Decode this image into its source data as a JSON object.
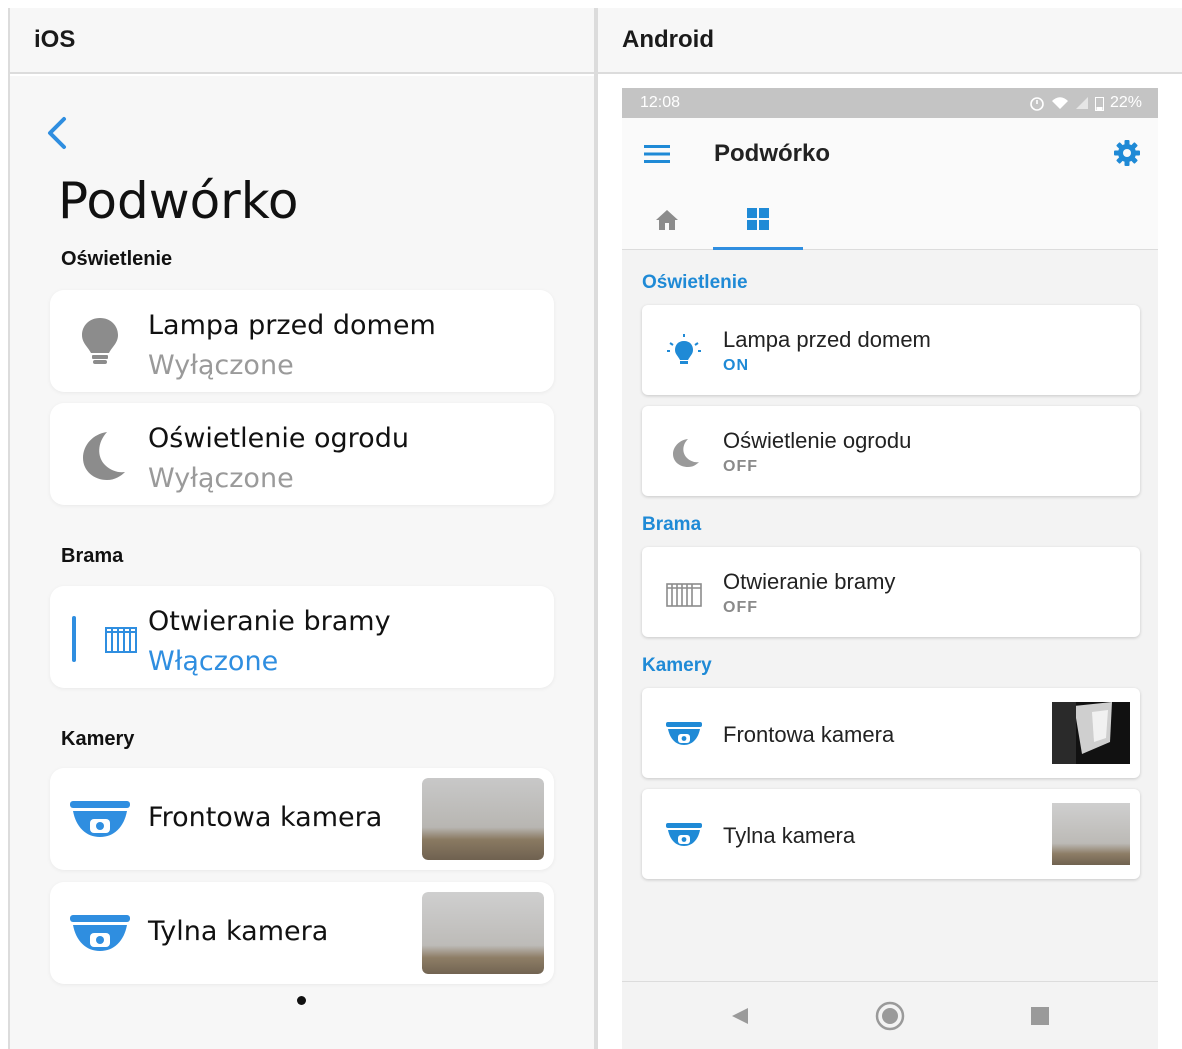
{
  "columns": {
    "ios": "iOS",
    "android": "Android"
  },
  "ios": {
    "title": "Podwórko",
    "sections": {
      "lighting": "Oświetlenie",
      "gate": "Brama",
      "cameras": "Kamery"
    },
    "devices": {
      "lamp": {
        "name": "Lampa przed domem",
        "state": "Wyłączone",
        "icon": "lightbulb-icon"
      },
      "garden": {
        "name": "Oświetlenie ogrodu",
        "state": "Wyłączone",
        "icon": "moon-icon"
      },
      "gate": {
        "name": "Otwieranie bramy",
        "state": "Włączone",
        "icon": "gate-icon"
      },
      "front_cam": {
        "name": "Frontowa kamera",
        "icon": "camera-icon"
      },
      "rear_cam": {
        "name": "Tylna kamera",
        "icon": "camera-icon"
      }
    }
  },
  "android": {
    "status": {
      "time": "12:08",
      "battery": "22%"
    },
    "title": "Podwórko",
    "sections": {
      "lighting": "Oświetlenie",
      "gate": "Brama",
      "cameras": "Kamery"
    },
    "devices": {
      "lamp": {
        "name": "Lampa przed domem",
        "state": "ON",
        "icon": "lightbulb-on-icon"
      },
      "garden": {
        "name": "Oświetlenie ogrodu",
        "state": "OFF",
        "icon": "moon-icon"
      },
      "gate": {
        "name": "Otwieranie bramy",
        "state": "OFF",
        "icon": "gate-icon"
      },
      "front_cam": {
        "name": "Frontowa kamera",
        "icon": "camera-icon"
      },
      "rear_cam": {
        "name": "Tylna kamera",
        "icon": "camera-icon"
      }
    }
  },
  "colors": {
    "accent": "#2f8ee0",
    "android_accent": "#1f8ad6",
    "off": "#9a9a9a"
  }
}
